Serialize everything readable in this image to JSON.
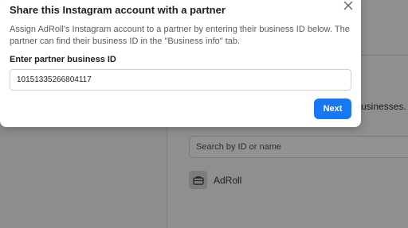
{
  "dialog": {
    "title": "Share this Instagram account with a partner",
    "description": "Assign AdRoll's Instagram account to a partner by entering their business ID below. The partner can find their business ID in the \"Business info\" tab.",
    "field_label": "Enter partner business ID",
    "field_value": "101513352668041​17",
    "next_label": "Next",
    "close_icon": "close-icon"
  },
  "background": {
    "snippet_text": "usinesses. Vi",
    "search_placeholder": "Search by ID or name",
    "partner_name": "AdRoll",
    "partner_icon": "briefcase-icon"
  },
  "colors": {
    "overlay": "#8c8d8e",
    "accent": "#1877f2"
  }
}
